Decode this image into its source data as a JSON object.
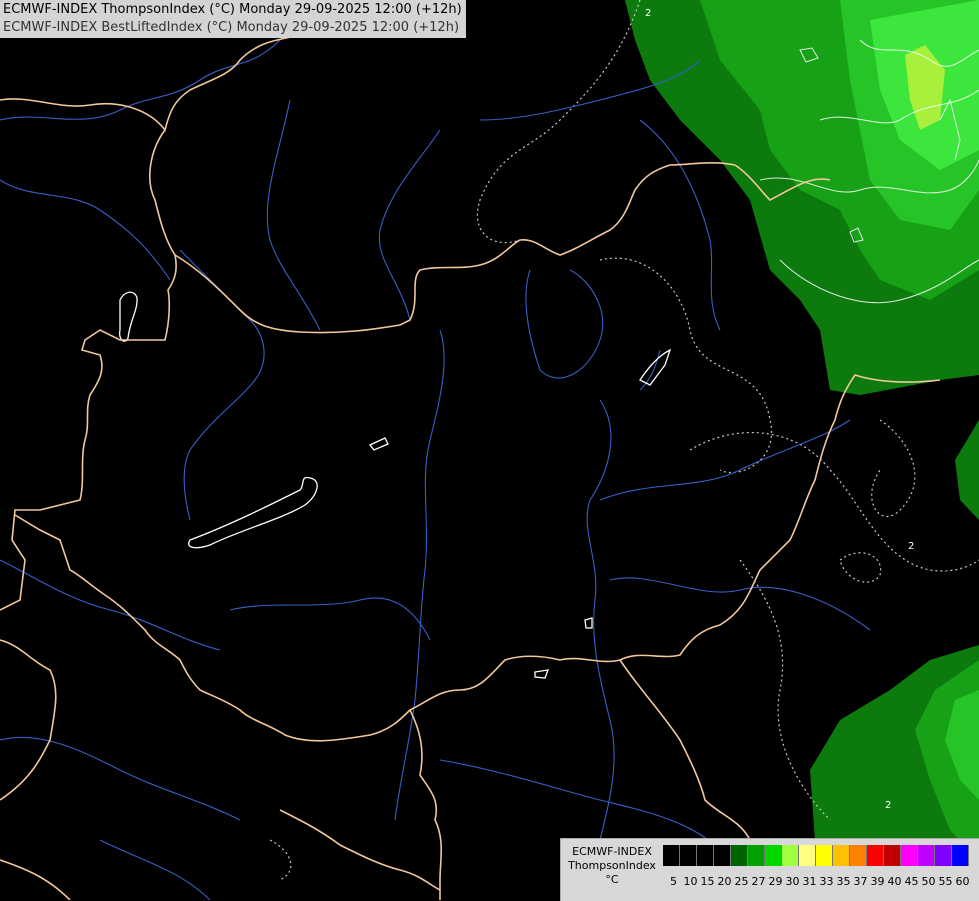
{
  "header": {
    "line1": "ECMWF-INDEX ThompsonIndex (°C) Monday 29-09-2025 12:00 (+12h)",
    "line2": "ECMWF-INDEX BestLiftedIndex (°C) Monday 29-09-2025 12:00 (+12h)"
  },
  "legend": {
    "title_line1": "ECMWF-INDEX",
    "title_line2": "ThompsonIndex",
    "unit": "°C",
    "swatches": [
      {
        "label": "5",
        "color": "#000000"
      },
      {
        "label": "10",
        "color": "#000000"
      },
      {
        "label": "15",
        "color": "#000000"
      },
      {
        "label": "20",
        "color": "#000000"
      },
      {
        "label": "25",
        "color": "#006400"
      },
      {
        "label": "27",
        "color": "#00a000"
      },
      {
        "label": "29",
        "color": "#00d800"
      },
      {
        "label": "30",
        "color": "#a0ff40"
      },
      {
        "label": "31",
        "color": "#ffff80"
      },
      {
        "label": "33",
        "color": "#ffff00"
      },
      {
        "label": "35",
        "color": "#ffc000"
      },
      {
        "label": "37",
        "color": "#ff8000"
      },
      {
        "label": "39",
        "color": "#ff0000"
      },
      {
        "label": "40",
        "color": "#c00000"
      },
      {
        "label": "45",
        "color": "#ff00ff"
      },
      {
        "label": "50",
        "color": "#c000ff"
      },
      {
        "label": "55",
        "color": "#8000ff"
      },
      {
        "label": "60",
        "color": "#0000ff"
      }
    ]
  },
  "contour_labels": [
    "2",
    "2",
    "2"
  ],
  "colors": {
    "background": "#000000",
    "border": "#f5c9a0",
    "river": "#4466cc",
    "lake_outline": "#ffffff",
    "contour_dotted": "#c8c8c8",
    "field_dark_green": "#0a6e0a",
    "field_green": "#1aa51a",
    "field_bright_green": "#35e135",
    "field_lime": "#9cf03c"
  }
}
